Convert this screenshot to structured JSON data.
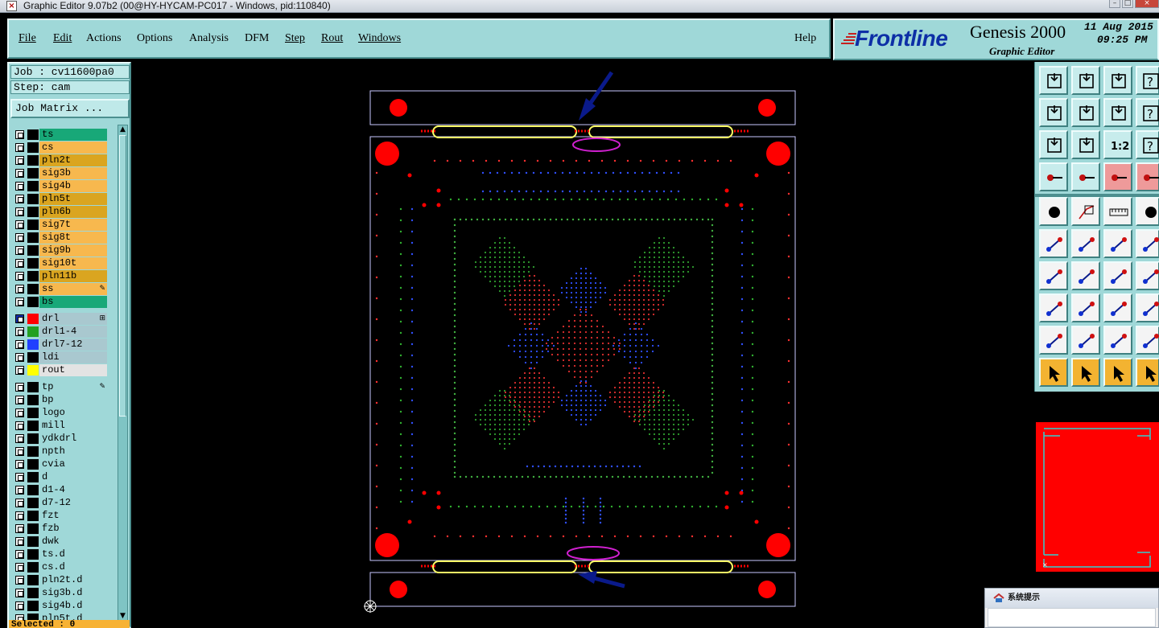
{
  "window": {
    "title": "Graphic Editor 9.07b2 (00@HY-HYCAM-PC017 - Windows, pid:110840)"
  },
  "menu": {
    "items": [
      {
        "label": "File"
      },
      {
        "label": "Edit"
      },
      {
        "label": "Actions"
      },
      {
        "label": "Options"
      },
      {
        "label": "Analysis"
      },
      {
        "label": "DFM"
      },
      {
        "label": "Step"
      },
      {
        "label": "Rout"
      },
      {
        "label": "Windows"
      }
    ],
    "help": "Help"
  },
  "brand": {
    "logo": "Frontline",
    "product": "Genesis 2000",
    "subtitle": "Graphic Editor",
    "date": "11 Aug 2015",
    "time": "09:25 PM"
  },
  "job": {
    "job_line": "Job : cv11600pa0",
    "step_line": "Step: cam",
    "matrix_button": "Job Matrix ..."
  },
  "layers": [
    {
      "name": "ts",
      "color": "#18a878",
      "swatch": "#000000",
      "mark": ""
    },
    {
      "name": "cs",
      "color": "#f7b84e",
      "swatch": "#000000",
      "mark": ""
    },
    {
      "name": "pln2t",
      "color": "#daa520",
      "swatch": "#000000",
      "mark": ""
    },
    {
      "name": "sig3b",
      "color": "#f7b84e",
      "swatch": "#000000",
      "mark": ""
    },
    {
      "name": "sig4b",
      "color": "#f7b84e",
      "swatch": "#000000",
      "mark": ""
    },
    {
      "name": "pln5t",
      "color": "#daa520",
      "swatch": "#000000",
      "mark": ""
    },
    {
      "name": "pln6b",
      "color": "#daa520",
      "swatch": "#000000",
      "mark": ""
    },
    {
      "name": "sig7t",
      "color": "#f7b84e",
      "swatch": "#000000",
      "mark": ""
    },
    {
      "name": "sig8t",
      "color": "#f7b84e",
      "swatch": "#000000",
      "mark": ""
    },
    {
      "name": "sig9b",
      "color": "#f7b84e",
      "swatch": "#000000",
      "mark": ""
    },
    {
      "name": "sig10t",
      "color": "#f7b84e",
      "swatch": "#000000",
      "mark": ""
    },
    {
      "name": "pln11b",
      "color": "#daa520",
      "swatch": "#000000",
      "mark": ""
    },
    {
      "name": "ss",
      "color": "#f7b84e",
      "swatch": "#000000",
      "mark": "✎"
    },
    {
      "name": "bs",
      "color": "#18a878",
      "swatch": "#000000",
      "mark": ""
    },
    {
      "name": "drl",
      "color": "#a9c8cf",
      "swatch": "#ff0000",
      "mark": "⊞",
      "active": true
    },
    {
      "name": "drl1-4",
      "color": "#a9c8cf",
      "swatch": "#22a022",
      "mark": ""
    },
    {
      "name": "drl7-12",
      "color": "#a9c8cf",
      "swatch": "#2040ff",
      "mark": ""
    },
    {
      "name": "ldi",
      "color": "#a9c8cf",
      "swatch": "#000000",
      "mark": ""
    },
    {
      "name": "rout",
      "color": "#e3e3e3",
      "swatch": "#ffff00",
      "mark": ""
    },
    {
      "name": "tp",
      "color": "#9fd8d8",
      "swatch": "#000000",
      "mark": "✎"
    },
    {
      "name": "bp",
      "color": "#9fd8d8",
      "swatch": "#000000",
      "mark": ""
    },
    {
      "name": "logo",
      "color": "#9fd8d8",
      "swatch": "#000000",
      "mark": ""
    },
    {
      "name": "mill",
      "color": "#9fd8d8",
      "swatch": "#000000",
      "mark": ""
    },
    {
      "name": "ydkdrl",
      "color": "#9fd8d8",
      "swatch": "#000000",
      "mark": ""
    },
    {
      "name": "npth",
      "color": "#9fd8d8",
      "swatch": "#000000",
      "mark": ""
    },
    {
      "name": "cvia",
      "color": "#9fd8d8",
      "swatch": "#000000",
      "mark": ""
    },
    {
      "name": "d",
      "color": "#9fd8d8",
      "swatch": "#000000",
      "mark": ""
    },
    {
      "name": "d1-4",
      "color": "#9fd8d8",
      "swatch": "#000000",
      "mark": ""
    },
    {
      "name": "d7-12",
      "color": "#9fd8d8",
      "swatch": "#000000",
      "mark": ""
    },
    {
      "name": "fzt",
      "color": "#9fd8d8",
      "swatch": "#000000",
      "mark": ""
    },
    {
      "name": "fzb",
      "color": "#9fd8d8",
      "swatch": "#000000",
      "mark": ""
    },
    {
      "name": "dwk",
      "color": "#9fd8d8",
      "swatch": "#000000",
      "mark": ""
    },
    {
      "name": "ts.d",
      "color": "#9fd8d8",
      "swatch": "#000000",
      "mark": ""
    },
    {
      "name": "cs.d",
      "color": "#9fd8d8",
      "swatch": "#000000",
      "mark": ""
    },
    {
      "name": "pln2t.d",
      "color": "#9fd8d8",
      "swatch": "#000000",
      "mark": ""
    },
    {
      "name": "sig3b.d",
      "color": "#9fd8d8",
      "swatch": "#000000",
      "mark": ""
    },
    {
      "name": "sig4b.d",
      "color": "#9fd8d8",
      "swatch": "#000000",
      "mark": ""
    },
    {
      "name": "pln5t.d",
      "color": "#9fd8d8",
      "swatch": "#000000",
      "mark": ""
    }
  ],
  "status": {
    "selected": "Selected : 0"
  },
  "popup": {
    "title": "系统提示"
  },
  "colors": {
    "panel": "#9fd8d8",
    "board_outline": "#c8c8ff",
    "pad_red": "#ff0000",
    "slot_yellow": "#ffff66",
    "marker_magenta": "#d020d0",
    "arrow_navy": "#0a1a8a"
  }
}
